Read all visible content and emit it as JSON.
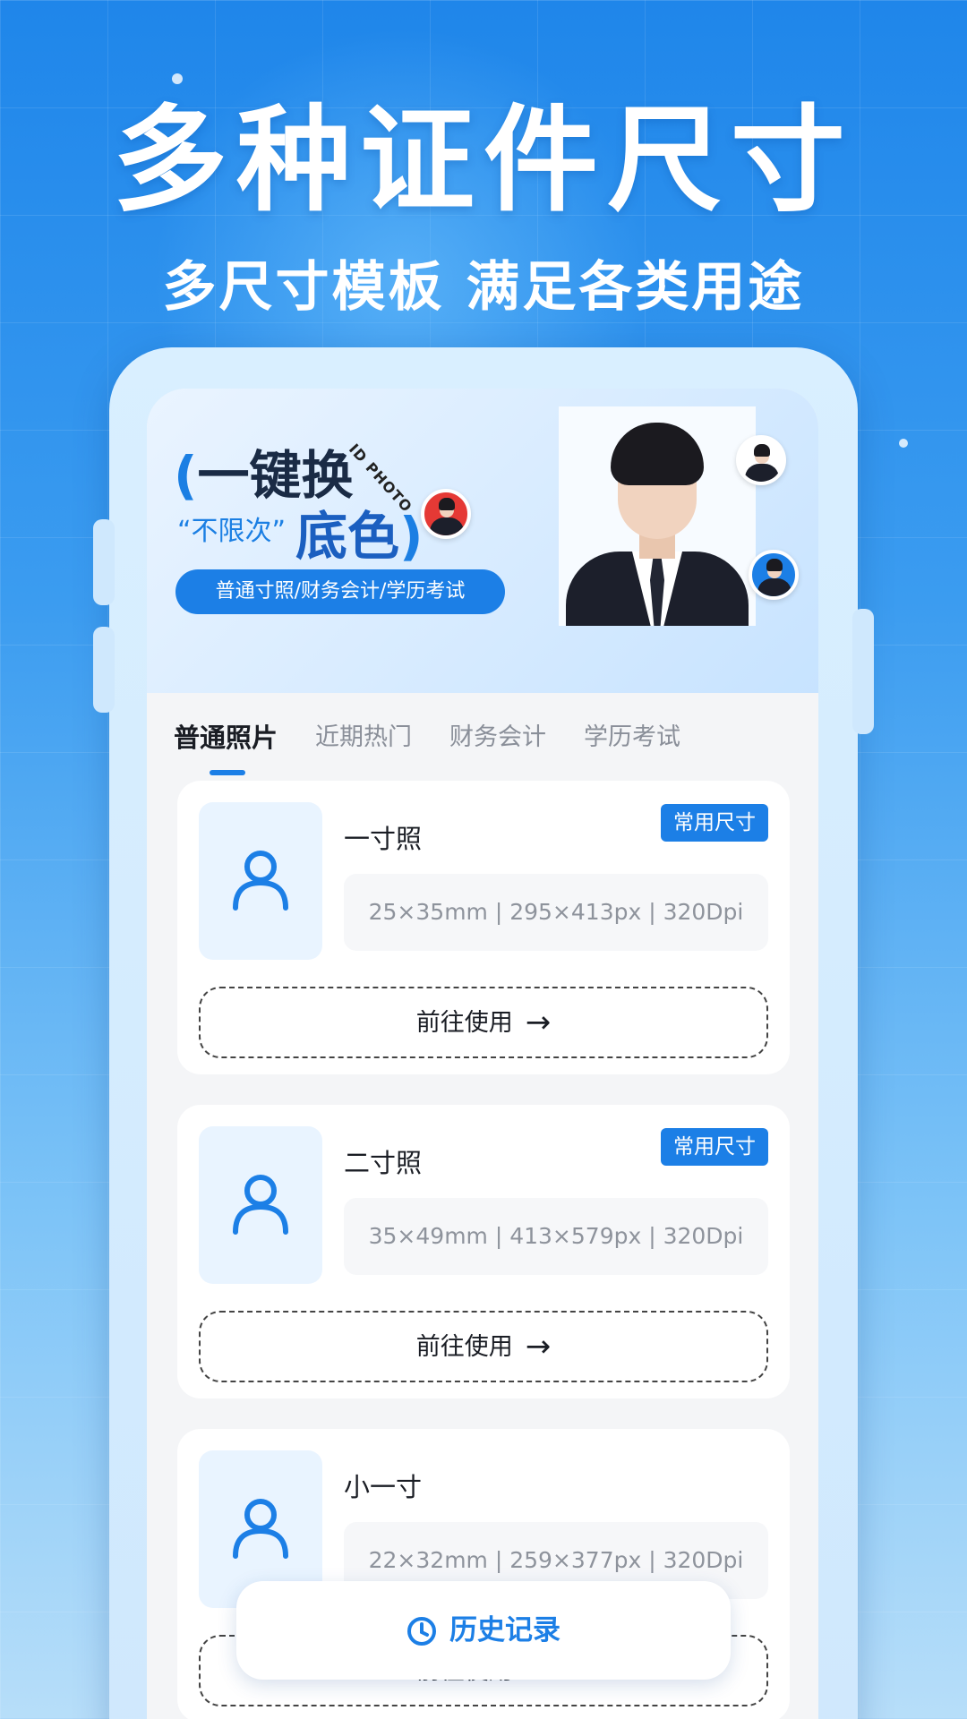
{
  "headline": "多种证件尺寸",
  "subheadline": "多尺寸模板 满足各类用途",
  "banner": {
    "title_line1": "一键换",
    "paren_left": "(",
    "paren_right": ")",
    "idphoto_tag": "ID PHOTO",
    "quote_text": "“不限次”",
    "title_line2": "底色",
    "pill": "普通寸照/财务会计/学历考试",
    "mini_colors": [
      "#ffffff",
      "#e53935",
      "#1c7fe6"
    ]
  },
  "tabs": [
    {
      "label": "普通照片",
      "active": true
    },
    {
      "label": "近期热门",
      "active": false
    },
    {
      "label": "财务会计",
      "active": false
    },
    {
      "label": "学历考试",
      "active": false
    }
  ],
  "cards": [
    {
      "name": "一寸照",
      "tag": "常用尺寸",
      "spec": "25×35mm | 295×413px | 320Dpi",
      "button": "前往使用"
    },
    {
      "name": "二寸照",
      "tag": "常用尺寸",
      "spec": "35×49mm | 413×579px | 320Dpi",
      "button": "前往使用"
    },
    {
      "name": "小一寸",
      "tag": "",
      "spec": "22×32mm | 259×377px | 320Dpi",
      "button": "前往使用"
    }
  ],
  "history_button": "历史记录",
  "icons": {
    "avatar": "user-outline-icon",
    "arrow": "arrow-right-icon",
    "history": "clock-icon"
  },
  "colors": {
    "accent": "#1c7fe6",
    "background_top": "#1f86ea",
    "card": "#ffffff"
  }
}
